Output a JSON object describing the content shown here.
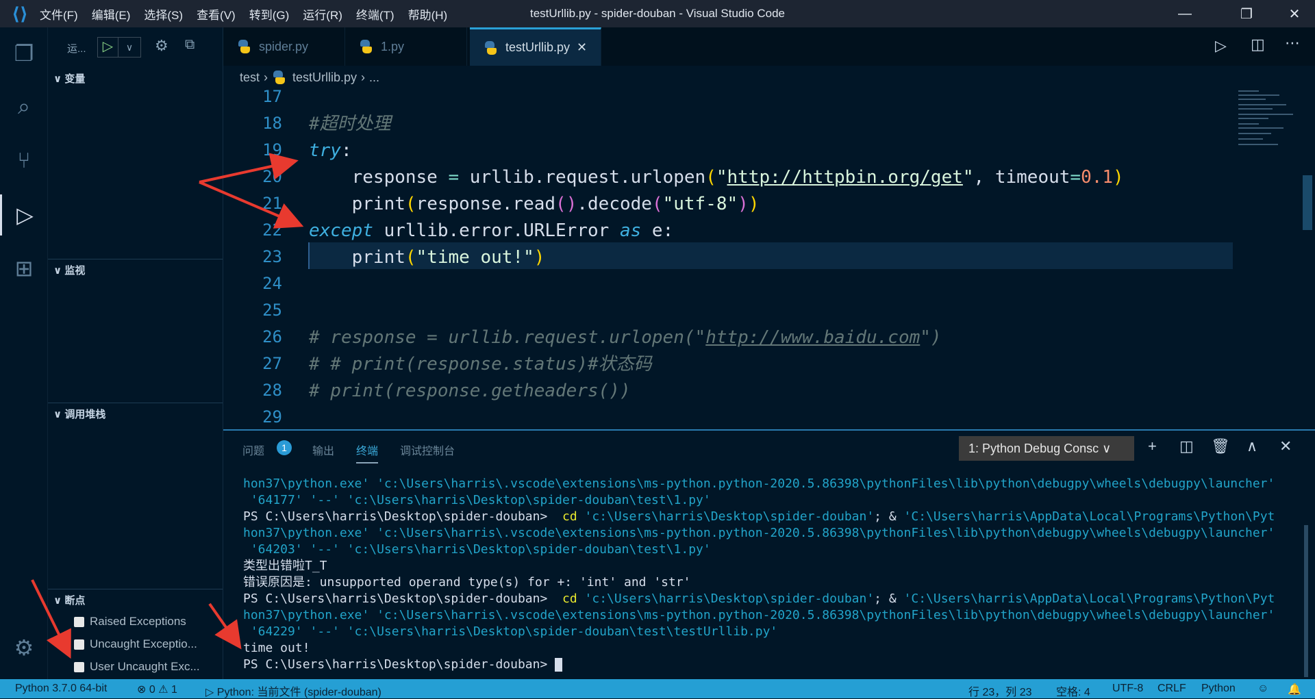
{
  "titlebar": {
    "menu": [
      "文件(F)",
      "编辑(E)",
      "选择(S)",
      "查看(V)",
      "转到(G)",
      "运行(R)",
      "终端(T)",
      "帮助(H)"
    ],
    "title": "testUrllib.py - spider-douban - Visual Studio Code"
  },
  "sidebar": {
    "run_label": "运...",
    "sections": {
      "variables": "变量",
      "watch": "监视",
      "callstack": "调用堆栈",
      "breakpoints": "断点"
    },
    "breakpoints": [
      "Raised Exceptions",
      "Uncaught Exceptio...",
      "User Uncaught Exc..."
    ]
  },
  "tabs": [
    {
      "label": "spider.py"
    },
    {
      "label": "1.py"
    },
    {
      "label": "testUrllib.py",
      "close": "✕"
    }
  ],
  "breadcrumb": {
    "folder": "test",
    "file": "testUrllib.py",
    "more": "..."
  },
  "editor": {
    "lines": [
      {
        "n": "17",
        "tokens": []
      },
      {
        "n": "18",
        "tokens": [
          {
            "t": "#超时处理",
            "c": "cm"
          }
        ]
      },
      {
        "n": "19",
        "tokens": [
          {
            "t": "try",
            "c": "kw"
          },
          {
            "t": ":",
            "c": "id"
          }
        ]
      },
      {
        "n": "20",
        "tokens": [
          {
            "t": "    response ",
            "c": "id"
          },
          {
            "t": "=",
            "c": "op"
          },
          {
            "t": " urllib.request.urlopen",
            "c": "id"
          },
          {
            "t": "(",
            "c": "p1"
          },
          {
            "t": "\"",
            "c": "str"
          },
          {
            "t": "http://httpbin.org/get",
            "c": "url"
          },
          {
            "t": "\"",
            "c": "str"
          },
          {
            "t": ", timeout",
            "c": "id"
          },
          {
            "t": "=",
            "c": "op"
          },
          {
            "t": "0.1",
            "c": "num"
          },
          {
            "t": ")",
            "c": "p1"
          }
        ]
      },
      {
        "n": "21",
        "tokens": [
          {
            "t": "    print",
            "c": "id"
          },
          {
            "t": "(",
            "c": "p1"
          },
          {
            "t": "response.read",
            "c": "id"
          },
          {
            "t": "()",
            "c": "p2"
          },
          {
            "t": ".decode",
            "c": "id"
          },
          {
            "t": "(",
            "c": "p2"
          },
          {
            "t": "\"utf-8\"",
            "c": "str"
          },
          {
            "t": ")",
            "c": "p2"
          },
          {
            "t": ")",
            "c": "p1"
          }
        ]
      },
      {
        "n": "22",
        "tokens": [
          {
            "t": "except",
            "c": "kw"
          },
          {
            "t": " urllib.error.URLError ",
            "c": "id"
          },
          {
            "t": "as",
            "c": "kw"
          },
          {
            "t": " e:",
            "c": "id"
          }
        ]
      },
      {
        "n": "23",
        "tokens": [
          {
            "t": "    print",
            "c": "id"
          },
          {
            "t": "(",
            "c": "p1"
          },
          {
            "t": "\"time out!\"",
            "c": "str"
          },
          {
            "t": ")",
            "c": "p1"
          }
        ]
      },
      {
        "n": "24",
        "tokens": []
      },
      {
        "n": "25",
        "tokens": []
      },
      {
        "n": "26",
        "tokens": [
          {
            "t": "# response = urllib.request.urlopen(\"",
            "c": "cm"
          },
          {
            "t": "http://www.baidu.com",
            "c": "cmu"
          },
          {
            "t": "\")",
            "c": "cm"
          }
        ]
      },
      {
        "n": "27",
        "tokens": [
          {
            "t": "# # print(response.status)#状态码",
            "c": "cm"
          }
        ]
      },
      {
        "n": "28",
        "tokens": [
          {
            "t": "# print(response.getheaders())",
            "c": "cm"
          }
        ]
      },
      {
        "n": "29",
        "tokens": []
      }
    ]
  },
  "panel": {
    "tabs": [
      "问题",
      "输出",
      "终端",
      "调试控制台"
    ],
    "problems_count": "1",
    "terminal_select": "1: Python Debug Consc",
    "terminal_lines": [
      [
        {
          "t": "hon37\\python.exe' 'c:\\Users\\harris\\.vscode\\extensions\\ms-python.python-2020.5.86398\\pythonFiles\\lib\\python\\debugpy\\wheels\\debugpy\\launcher'",
          "c": "t-c"
        }
      ],
      [
        {
          "t": " '64177' '--' 'c:\\Users\\harris\\Desktop\\spider-douban\\test\\1.py'",
          "c": "t-c"
        }
      ],
      [
        {
          "t": "PS C:\\Users\\harris\\Desktop\\spider-douban>  ",
          "c": "t-w"
        },
        {
          "t": "cd",
          "c": "t-y"
        },
        {
          "t": " 'c:\\Users\\harris\\Desktop\\spider-douban'",
          "c": "t-c"
        },
        {
          "t": "; & ",
          "c": "t-w"
        },
        {
          "t": "'C:\\Users\\harris\\AppData\\Local\\Programs\\Python\\Pyt",
          "c": "t-c"
        }
      ],
      [
        {
          "t": "hon37\\python.exe' 'c:\\Users\\harris\\.vscode\\extensions\\ms-python.python-2020.5.86398\\pythonFiles\\lib\\python\\debugpy\\wheels\\debugpy\\launcher'",
          "c": "t-c"
        }
      ],
      [
        {
          "t": " '64203' '--' 'c:\\Users\\harris\\Desktop\\spider-douban\\test\\1.py'",
          "c": "t-c"
        }
      ],
      [
        {
          "t": "类型出错啦T_T",
          "c": "t-w"
        }
      ],
      [
        {
          "t": "错误原因是: unsupported operand type(s) for +: 'int' and 'str'",
          "c": "t-w"
        }
      ],
      [
        {
          "t": "PS C:\\Users\\harris\\Desktop\\spider-douban>  ",
          "c": "t-w"
        },
        {
          "t": "cd",
          "c": "t-y"
        },
        {
          "t": " 'c:\\Users\\harris\\Desktop\\spider-douban'",
          "c": "t-c"
        },
        {
          "t": "; & ",
          "c": "t-w"
        },
        {
          "t": "'C:\\Users\\harris\\AppData\\Local\\Programs\\Python\\Pyt",
          "c": "t-c"
        }
      ],
      [
        {
          "t": "hon37\\python.exe' 'c:\\Users\\harris\\.vscode\\extensions\\ms-python.python-2020.5.86398\\pythonFiles\\lib\\python\\debugpy\\wheels\\debugpy\\launcher'",
          "c": "t-c"
        }
      ],
      [
        {
          "t": " '64229' '--' 'c:\\Users\\harris\\Desktop\\spider-douban\\test\\testUrllib.py'",
          "c": "t-c"
        }
      ],
      [
        {
          "t": "time out!",
          "c": "t-w"
        }
      ],
      [
        {
          "t": "PS C:\\Users\\harris\\Desktop\\spider-douban> ",
          "c": "t-w"
        }
      ]
    ]
  },
  "statusbar": {
    "interpreter": "Python 3.7.0 64-bit",
    "errors": "0",
    "warnings": "1",
    "debug_config": "Python: 当前文件 (spider-douban)",
    "position": "行 23，列 23",
    "spaces": "空格: 4",
    "encoding": "UTF-8",
    "eol": "CRLF",
    "language": "Python"
  },
  "colors": {
    "statusbar": "#259fd4",
    "accent": "#2aa0d6",
    "annotation": "#e83a2f"
  }
}
